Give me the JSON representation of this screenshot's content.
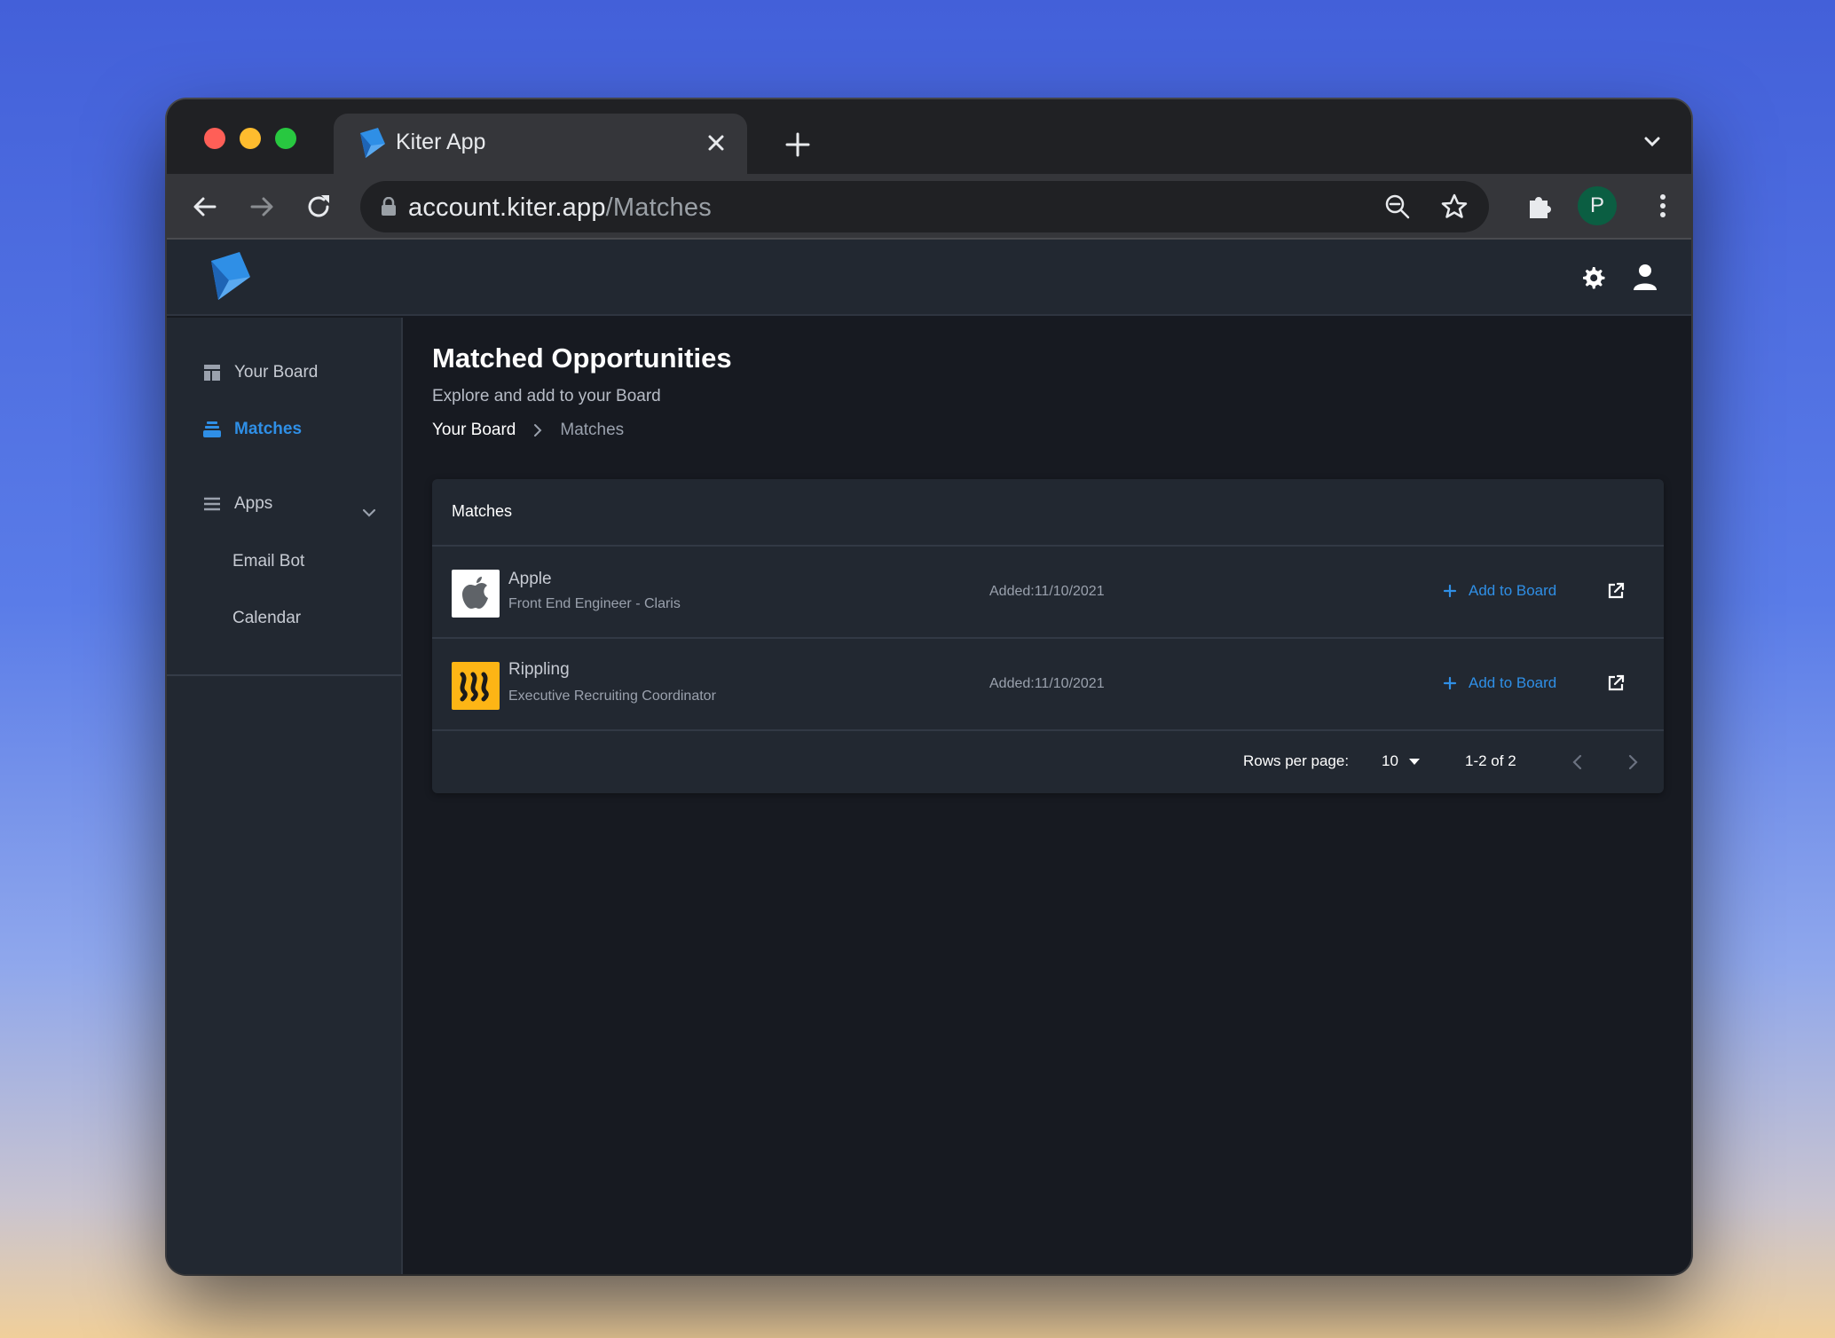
{
  "browser": {
    "tab_title": "Kiter App",
    "url_host": "account.kiter.app",
    "url_path": "/Matches",
    "profile_initial": "P"
  },
  "sidebar": {
    "items": [
      {
        "label": "Your Board",
        "icon": "dashboard-icon"
      },
      {
        "label": "Matches",
        "icon": "stack-icon",
        "active": true
      },
      {
        "label": "Apps",
        "icon": "list-icon"
      }
    ],
    "sub_items": [
      "Email Bot",
      "Calendar"
    ]
  },
  "main": {
    "title": "Matched Opportunities",
    "subtitle": "Explore and add to your Board",
    "breadcrumb": [
      "Your Board",
      "Matches"
    ],
    "card_title": "Matches",
    "rows": [
      {
        "company": "Apple",
        "position": "Front End Engineer - Claris",
        "added": "Added:11/10/2021",
        "action": "Add to Board",
        "logo": "apple-logo-icon"
      },
      {
        "company": "Rippling",
        "position": "Executive Recruiting Coordinator",
        "added": "Added:11/10/2021",
        "action": "Add to Board",
        "logo": "rippling-logo-icon"
      }
    ],
    "pagination": {
      "rows_per_page_label": "Rows per page:",
      "rows_per_page": "10",
      "range": "1-2 of 2"
    }
  },
  "colors": {
    "accent": "#2f8fe6",
    "app_bg": "#171a21",
    "panel_bg": "#222831",
    "rippling_yellow": "#fdb515"
  }
}
